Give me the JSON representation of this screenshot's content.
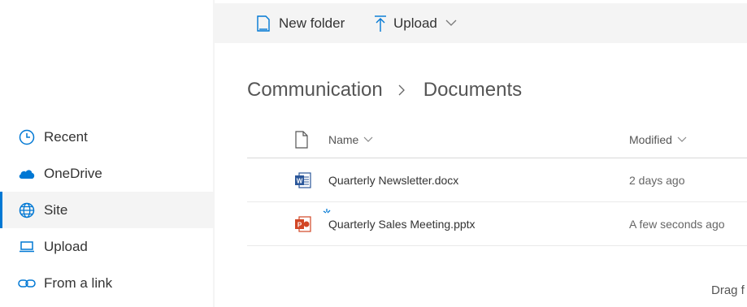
{
  "command_bar": {
    "new_folder_label": "New folder",
    "upload_label": "Upload"
  },
  "sidebar": {
    "items": [
      {
        "label": "Recent",
        "icon": "clock-icon",
        "active": false
      },
      {
        "label": "OneDrive",
        "icon": "cloud-icon",
        "active": false
      },
      {
        "label": "Site",
        "icon": "globe-icon",
        "active": true
      },
      {
        "label": "Upload",
        "icon": "laptop-icon",
        "active": false
      },
      {
        "label": "From a link",
        "icon": "link-icon",
        "active": false
      }
    ]
  },
  "breadcrumb": {
    "items": [
      "Communication",
      "Documents"
    ]
  },
  "file_list": {
    "columns": {
      "name": "Name",
      "modified": "Modified"
    },
    "rows": [
      {
        "name": "Quarterly Newsletter.docx",
        "modified": "2 days ago",
        "type": "word-file-icon"
      },
      {
        "name": "Quarterly Sales Meeting.pptx",
        "modified": "A few seconds ago",
        "type": "powerpoint-file-icon"
      }
    ]
  },
  "drag_hint": "Drag f",
  "colors": {
    "accent": "#0078d4",
    "word": "#2b579a",
    "powerpoint": "#d24726",
    "sidebar_active_bg": "#f4f4f4"
  }
}
